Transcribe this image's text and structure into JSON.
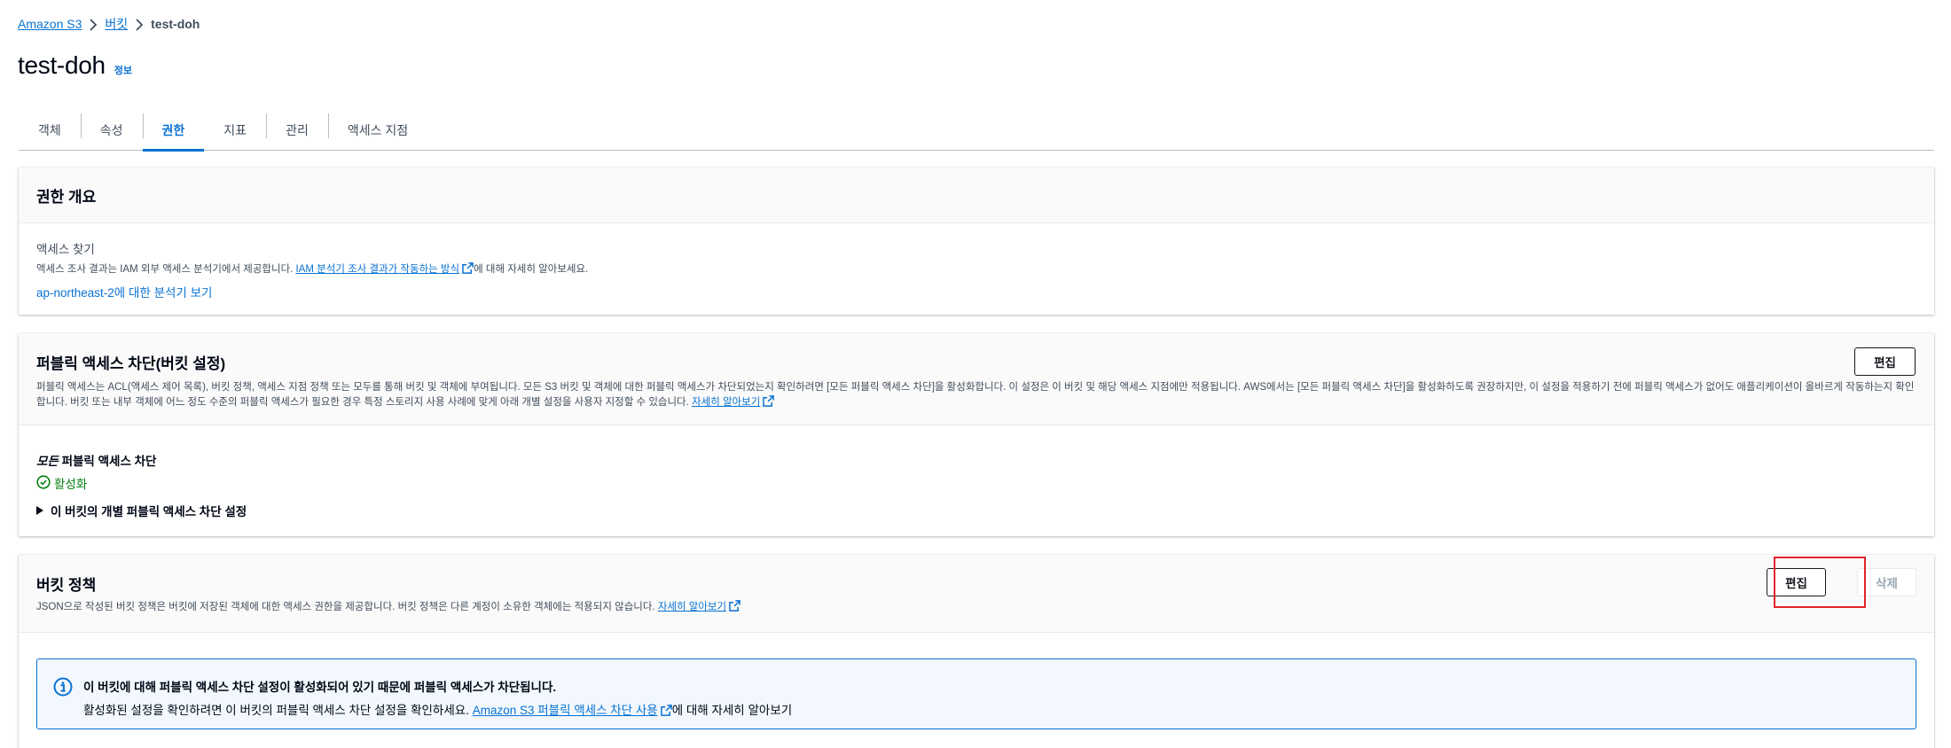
{
  "breadcrumb": {
    "items": [
      "Amazon S3",
      "버킷"
    ],
    "current": "test-doh"
  },
  "page": {
    "title": "test-doh",
    "info_link": "정보"
  },
  "tabs": [
    {
      "label": "객체"
    },
    {
      "label": "속성"
    },
    {
      "label": "권한",
      "active": true
    },
    {
      "label": "지표"
    },
    {
      "label": "관리"
    },
    {
      "label": "액세스 지점"
    }
  ],
  "permissions_overview": {
    "title": "권한 개요",
    "access_findings_label": "액세스 찾기",
    "desc_prefix": "액세스 조사 결과는 IAM 외부 액세스 분석기에서 제공합니다. ",
    "desc_link": "IAM 분석기 조사 결과가 작동하는 방식",
    "desc_suffix": "에 대해 자세히 알아보세요.",
    "analyzer_link": "ap-northeast-2에 대한 분석기 보기"
  },
  "block_public_access": {
    "title": "퍼블릭 액세스 차단(버킷 설정)",
    "edit_label": "편집",
    "description": "퍼블릭 액세스는 ACL(액세스 제어 목록), 버킷 정책, 액세스 지점 정책 또는 모두를 통해 버킷 및 객체에 부여됩니다. 모든 S3 버킷 및 객체에 대한 퍼블릭 액세스가 차단되었는지 확인하려면 [모든 퍼블릭 액세스 차단]을 활성화합니다. 이 설정은 이 버킷 및 해당 액세스 지점에만 적용됩니다. AWS에서는 [모든 퍼블릭 액세스 차단]을 활성화하도록 권장하지만, 이 설정을 적용하기 전에 퍼블릭 액세스가 없어도 애플리케이션이 올바르게 작동하는지 확인합니다. 버킷 또는 내부 객체에 어느 정도 수준의 퍼블릭 액세스가 필요한 경우 특정 스토리지 사용 사례에 맞게 아래 개별 설정을 사용자 지정할 수 있습니다. ",
    "learn_more": "자세히 알아보기",
    "setting_label_em": "모든",
    "setting_label_rest": " 퍼블릭 액세스 차단",
    "status": "활성화",
    "expander_label": "이 버킷의 개별 퍼블릭 액세스 차단 설정"
  },
  "bucket_policy": {
    "title": "버킷 정책",
    "description": "JSON으로 작성된 버킷 정책은 버킷에 저장된 객체에 대한 액세스 권한을 제공합니다. 버킷 정책은 다른 계정이 소유한 객체에는 적용되지 않습니다. ",
    "learn_more": "자세히 알아보기",
    "edit_label": "편집",
    "delete_label": "삭제",
    "alert": {
      "title": "이 버킷에 대해 퍼블릭 액세스 차단 설정이 활성화되어 있기 때문에 퍼블릭 액세스가 차단됩니다.",
      "text_prefix": "활성화된 설정을 확인하려면 이 버킷의 퍼블릭 액세스 차단 설정을 확인하세요. ",
      "link": "Amazon S3 퍼블릭 액세스 차단 사용",
      "text_suffix": "에 대해 자세히 알아보기"
    }
  },
  "colors": {
    "link": "#0972d3",
    "success": "#037f0c",
    "highlight": "#e0262a",
    "info_bg": "#f2f8fd"
  }
}
